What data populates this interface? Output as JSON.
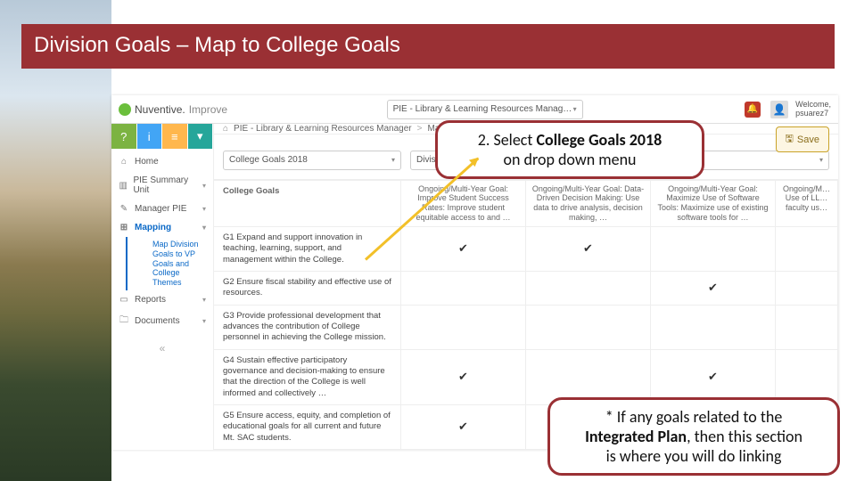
{
  "slide": {
    "title_pre": "Division Goals",
    "title_dash": " – ",
    "title_post": "Map to College Goals"
  },
  "brand": {
    "name": "Nuventive.",
    "sub": "Improve"
  },
  "header": {
    "unit_dropdown": "PIE - Library & Learning Resources Manag…",
    "welcome_label": "Welcome,",
    "welcome_user": "psuarez7",
    "notification_glyph": "🔔"
  },
  "sidebar": {
    "quick": [
      "?",
      "i",
      "≡",
      "▾"
    ],
    "items": [
      {
        "label": "Home",
        "icon": "⌂"
      },
      {
        "label": "PIE Summary Unit",
        "icon": "▥"
      },
      {
        "label": "Manager PIE",
        "icon": "✎"
      },
      {
        "label": "Mapping",
        "icon": "⊞",
        "active": true
      },
      {
        "label": "Reports",
        "icon": "▭"
      },
      {
        "label": "Documents",
        "icon": "🗀"
      }
    ],
    "mapping_sub": "Map Division Goals to VP Goals and College Themes",
    "collapse_glyph": "«"
  },
  "breadcrumb": {
    "home_glyph": "⌂",
    "seg1": "PIE - Library & Learning Resources Manager",
    "seg2": "Mapping"
  },
  "toolbar": {
    "save_label": "Save"
  },
  "filters": {
    "left_select": "College Goals 2018",
    "right_select": "Division Goals"
  },
  "grid": {
    "row_header": "College Goals",
    "cols": [
      "Ongoing/Multi-Year Goal: Improve Student Success Rates: Improve student equitable access to and …",
      "Ongoing/Multi-Year Goal: Data-Driven Decision Making: Use data to drive analysis, decision making, …",
      "Ongoing/Multi-Year Goal: Maximize Use of Software Tools: Maximize use of existing software tools for …",
      "Ongoing/M… Use of LL… faculty us…"
    ],
    "rows": [
      {
        "label": "G1 Expand and support innovation in teaching, learning, support, and management within the College.",
        "checks": [
          true,
          true,
          false,
          false
        ]
      },
      {
        "label": "G2 Ensure fiscal stability and effective use of resources.",
        "checks": [
          false,
          false,
          true,
          false
        ]
      },
      {
        "label": "G3 Provide professional development that advances the contribution of College personnel in achieving the College mission.",
        "checks": [
          false,
          false,
          false,
          false
        ]
      },
      {
        "label": "G4 Sustain effective participatory governance and decision-making to ensure that the direction of the College is well informed and collectively …",
        "checks": [
          true,
          false,
          true,
          false
        ]
      },
      {
        "label": "G5 Ensure access, equity, and completion of educational goals for all current and future Mt. SAC students.",
        "checks": [
          true,
          false,
          false,
          false
        ]
      }
    ]
  },
  "callouts": {
    "c1_line1_pre": "2. Select ",
    "c1_line1_bold": "College Goals 2018",
    "c1_line2": "on drop down menu",
    "c2_line1": "* If any goals related to the",
    "c2_line2_bold": "Integrated Plan",
    "c2_line2_post": ", then this section",
    "c2_line3": "is where you will do linking"
  },
  "glyphs": {
    "chev_down": "▾",
    "check": "✔",
    "floppy": "🖫",
    "gt": ">"
  }
}
